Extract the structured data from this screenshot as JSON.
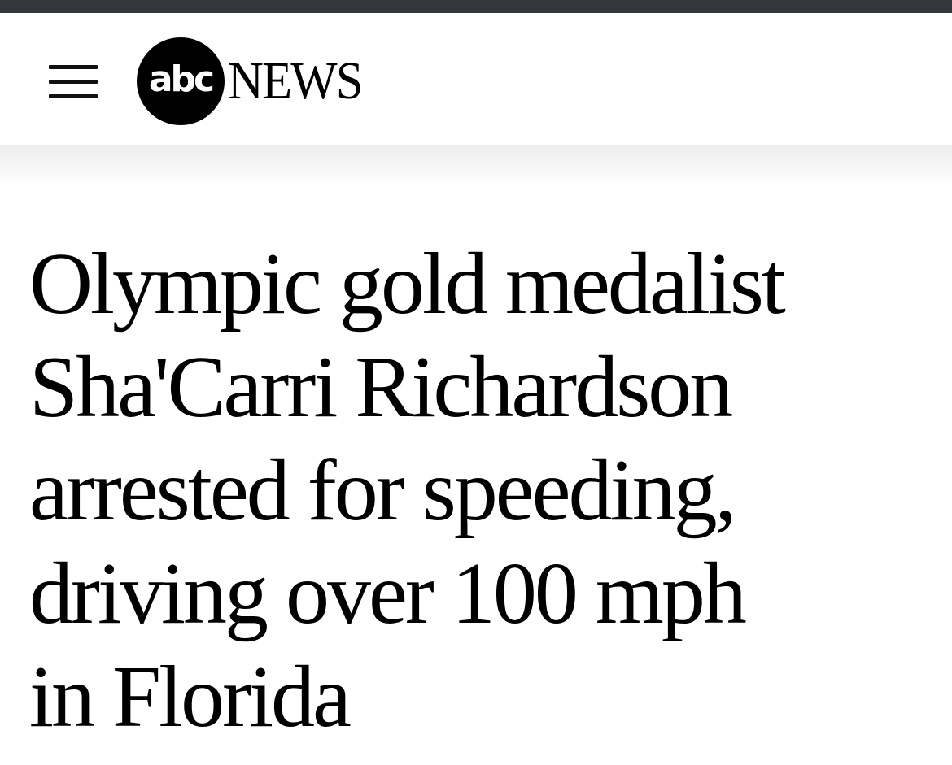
{
  "header": {
    "menu_icon": "hamburger-menu-icon",
    "logo": {
      "abc_text": "abc",
      "news_text": "NEWS"
    }
  },
  "article": {
    "headline": "Olympic gold medalist\nSha'Carri Richardson\narrested for speeding,\ndriving over 100 mph\nin Florida"
  },
  "colors": {
    "top_strip": "#33373b",
    "text": "#000000",
    "background": "#ffffff"
  }
}
